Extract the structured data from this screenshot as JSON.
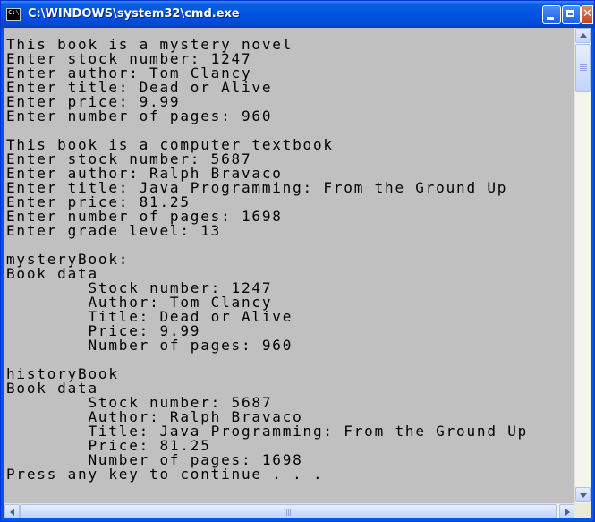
{
  "window": {
    "title": "C:\\WINDOWS\\system32\\cmd.exe",
    "icon": "cmd-icon",
    "icon_text": "C:\\",
    "controls": {
      "minimize": "minimize-icon",
      "maximize": "maximize-icon",
      "close_glyph": "✕"
    }
  },
  "console": {
    "background": "#c0c0c0",
    "text_color": "#000000",
    "output": "This book is a mystery novel\nEnter stock number: 1247\nEnter author: Tom Clancy\nEnter title: Dead or Alive\nEnter price: 9.99\nEnter number of pages: 960\n\nThis book is a computer textbook\nEnter stock number: 5687\nEnter author: Ralph Bravaco\nEnter title: Java Programming: From the Ground Up\nEnter price: 81.25\nEnter number of pages: 1698\nEnter grade level: 13\n\nmysteryBook:\nBook data\n\tStock number: 1247\n\tAuthor: Tom Clancy\n\tTitle: Dead or Alive\n\tPrice: 9.99\n\tNumber of pages: 960\n\nhistoryBook\nBook data\n\tStock number: 5687\n\tAuthor: Ralph Bravaco\n\tTitle: Java Programming: From the Ground Up\n\tPrice: 81.25\n\tNumber of pages: 1698\nPress any key to continue . . ."
  },
  "scrollbars": {
    "vertical_position": 0.0,
    "horizontal_position": 0.0
  }
}
